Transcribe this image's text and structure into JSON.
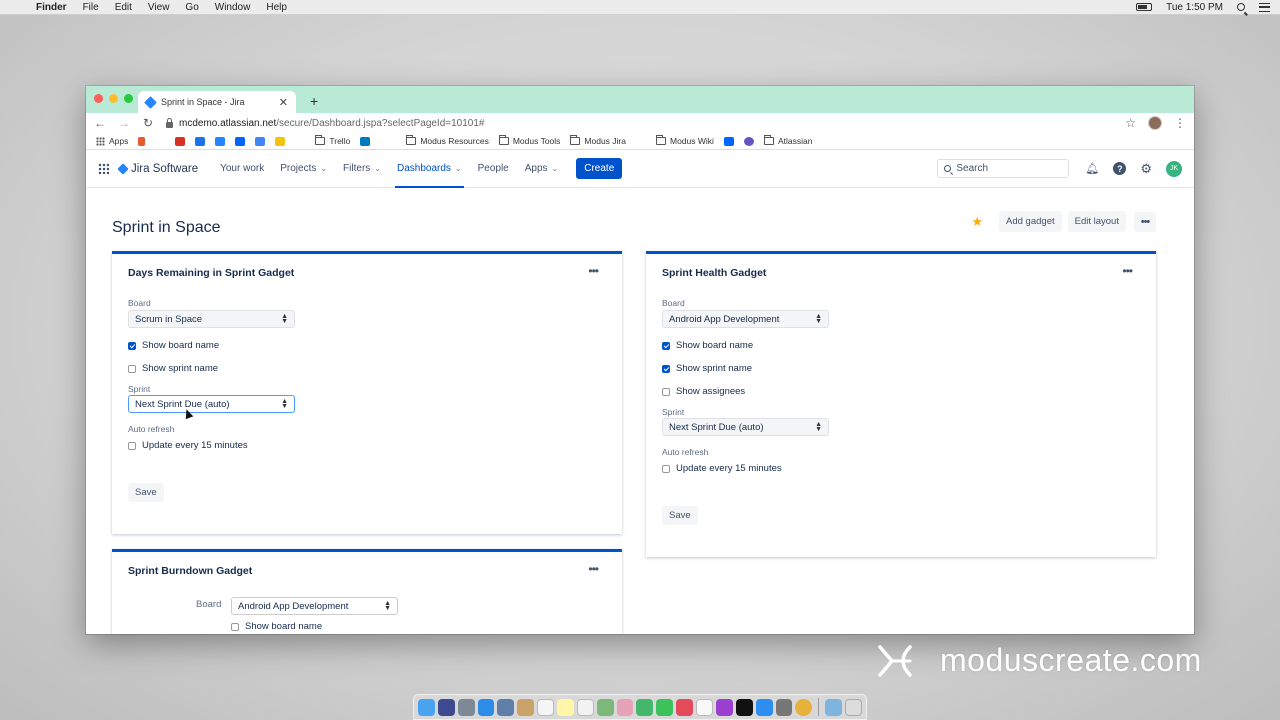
{
  "menubar": {
    "app": "Finder",
    "items": [
      "File",
      "Edit",
      "View",
      "Go",
      "Window",
      "Help"
    ],
    "clock": "Tue 1:50 PM"
  },
  "browser": {
    "tab_title": "Sprint in Space - Jira",
    "url_host": "mcdemo.atlassian.net",
    "url_path": "/secure/Dashboard.jspa?selectPageId=10101#",
    "bookmarks": {
      "apps": "Apps",
      "trello": "Trello",
      "modus_resources": "Modus Resources",
      "modus_tools": "Modus Tools",
      "modus_jira": "Modus Jira",
      "modus_wiki": "Modus Wiki",
      "atlassian": "Atlassian"
    }
  },
  "jira": {
    "product": "Jira Software",
    "nav": {
      "your_work": "Your work",
      "projects": "Projects",
      "filters": "Filters",
      "dashboards": "Dashboards",
      "people": "People",
      "apps": "Apps",
      "create": "Create"
    },
    "search_placeholder": "Search",
    "avatar_initials": "JK"
  },
  "dashboard": {
    "title": "Sprint in Space",
    "add_gadget": "Add gadget",
    "edit_layout": "Edit layout"
  },
  "gadgets": {
    "days_remaining": {
      "title": "Days Remaining in Sprint Gadget",
      "board_label": "Board",
      "board_value": "Scrum in Space",
      "show_board_name": "Show board name",
      "show_board_name_checked": true,
      "show_sprint_name": "Show sprint name",
      "show_sprint_name_checked": false,
      "sprint_label": "Sprint",
      "sprint_value": "Next Sprint Due (auto)",
      "auto_refresh_label": "Auto refresh",
      "update_every": "Update every 15 minutes",
      "save": "Save"
    },
    "sprint_health": {
      "title": "Sprint Health Gadget",
      "board_label": "Board",
      "board_value": "Android App Development",
      "show_board_name": "Show board name",
      "show_sprint_name": "Show sprint name",
      "show_assignees": "Show assignees",
      "sprint_label": "Sprint",
      "sprint_value": "Next Sprint Due (auto)",
      "auto_refresh_label": "Auto refresh",
      "update_every": "Update every 15 minutes",
      "save": "Save"
    },
    "sprint_burndown": {
      "title": "Sprint Burndown Gadget",
      "board_label": "Board",
      "board_value": "Android App Development",
      "show_board_name": "Show board name"
    }
  },
  "watermark": "moduscreate.com",
  "colors": {
    "tabstrip": "#b9ead6",
    "jira_blue": "#0052cc",
    "star": "#ffab00",
    "avatar": "#36b37e"
  }
}
